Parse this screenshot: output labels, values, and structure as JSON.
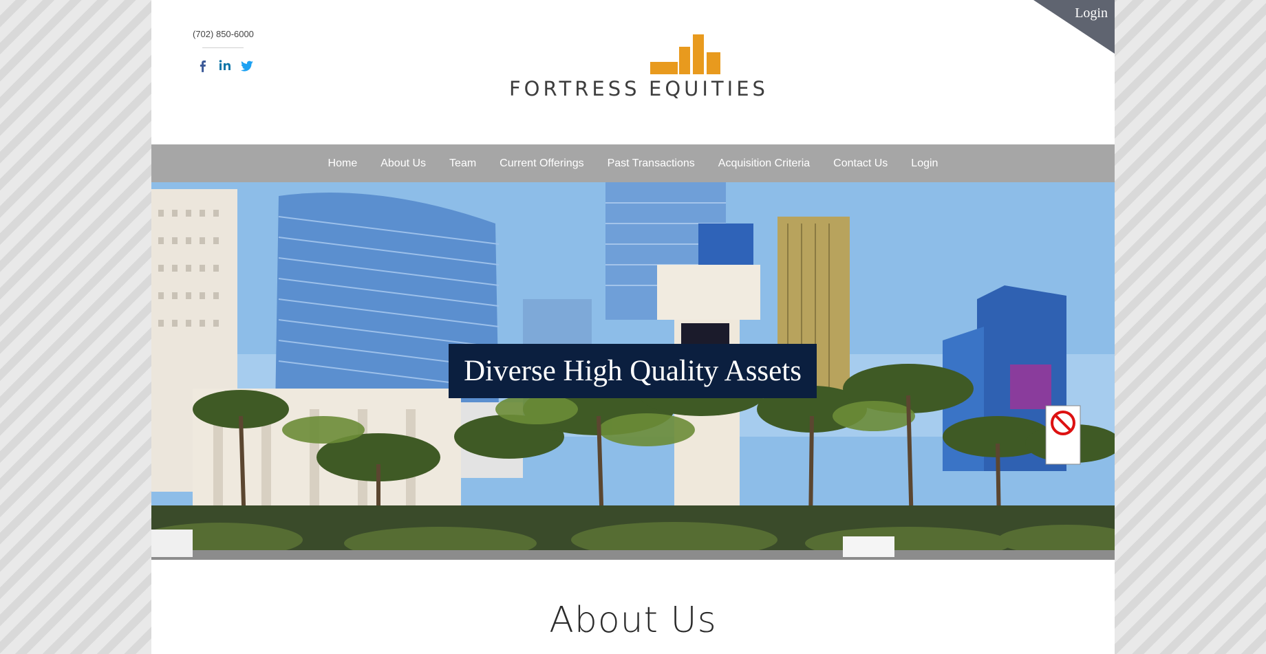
{
  "header": {
    "phone": "(702) 850-6000",
    "social": [
      {
        "name": "facebook-icon",
        "color": "#3b5998"
      },
      {
        "name": "linkedin-icon",
        "color": "#0e76a8"
      },
      {
        "name": "twitter-icon",
        "color": "#1da1f2"
      }
    ],
    "logo": {
      "word1": "FORTRESS",
      "word2": "EQUITIES",
      "bar_color": "#e89a1e",
      "text_color": "#3d3d3d"
    },
    "corner_login": "Login"
  },
  "nav": {
    "items": [
      {
        "label": "Home"
      },
      {
        "label": "About Us"
      },
      {
        "label": "Team"
      },
      {
        "label": "Current Offerings"
      },
      {
        "label": "Past Transactions"
      },
      {
        "label": "Acquisition Criteria"
      },
      {
        "label": "Contact Us"
      },
      {
        "label": "Login"
      }
    ],
    "background": "#a6a6a6"
  },
  "hero": {
    "caption": "Diverse High Quality Assets",
    "caption_bg": "#0b1f3f"
  },
  "main": {
    "section_title": "About Us"
  }
}
